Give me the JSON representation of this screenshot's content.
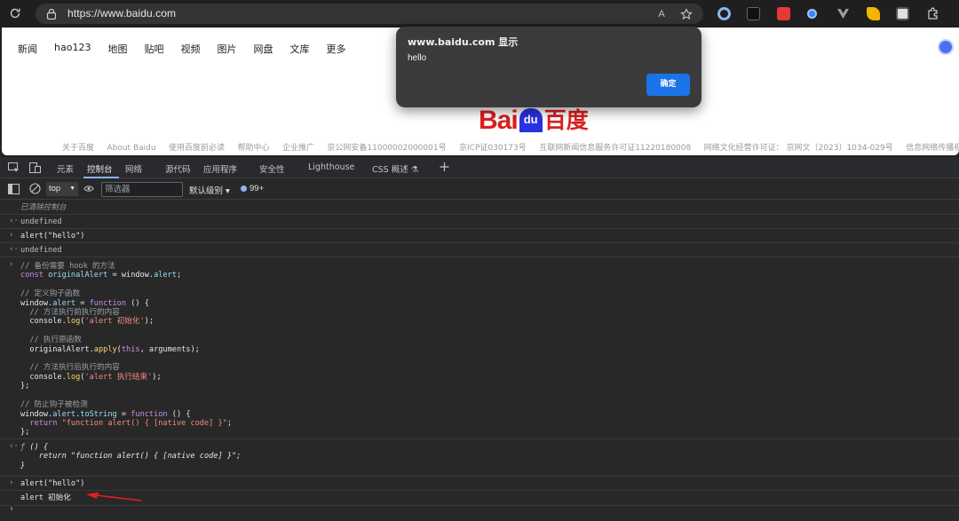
{
  "browser": {
    "url": "https://www.baidu.com",
    "read_aloud_icon": "A",
    "extensions": [
      "ext-circle-icon",
      "ext-tweak-icon",
      "ext-red-icon",
      "ext-blue-icon",
      "ext-vue-icon",
      "ext-yellow-icon",
      "ext-eye-icon",
      "ext-puzzle-icon"
    ]
  },
  "baidu": {
    "nav": [
      "新闻",
      "hao123",
      "地图",
      "贴吧",
      "视频",
      "图片",
      "网盘",
      "文库",
      "更多"
    ],
    "logo_text_latin": "Bai",
    "logo_text_paw": "du",
    "logo_text_cn": "百度",
    "footer": [
      "关于百度",
      "About Baidu",
      "使用百度前必读",
      "帮助中心",
      "企业推广",
      "京公网安备11000002000001号",
      "京ICP证030173号",
      "互联网新闻信息服务许可证11220180008",
      "网络文化经营许可证： 京网文〔2023〕1034-029号",
      "信息网络传播视听节目许可证"
    ]
  },
  "dialog": {
    "title": "www.baidu.com 显示",
    "message": "hello",
    "ok_label": "确定"
  },
  "devtools": {
    "tabs": [
      "元素",
      "控制台",
      "网络",
      "源代码",
      "应用程序",
      "安全性",
      "Lighthouse",
      "CSS 概述 ⚗"
    ],
    "active_tab": "控制台",
    "context": "top",
    "filter_placeholder": "筛选器",
    "levels": "默认级别 ▾",
    "issues_count": "99+"
  },
  "console": {
    "cleared": "已清除控制台",
    "undefined": "undefined",
    "cmd1": "alert(\"hello\")",
    "hook_code": {
      "l1_comment": "// 备份需要 hook 的方法",
      "l2_const": "const",
      "l2_var": "originalAlert",
      "l2_rest": " = window.",
      "l2_prop": "alert",
      "l3_comment": "// 定义钩子函数",
      "l4_a": "window.",
      "l4_prop": "alert",
      "l4_b": " = ",
      "l4_fn": "function",
      "l4_c": " () {",
      "l5_comment": "// 方法执行前执行的内容",
      "l6_a": "console.",
      "l6_fn": "log",
      "l6_b": "(",
      "l6_str": "'alert 初始化'",
      "l6_c": ");",
      "l7_comment": "// 执行原函数",
      "l8_a": "originalAlert.",
      "l8_fn": "apply",
      "l8_b": "(",
      "l8_kw": "this",
      "l8_c": ", arguments);",
      "l9_comment": "// 方法执行后执行的内容",
      "l10_a": "console.",
      "l10_fn": "log",
      "l10_b": "(",
      "l10_str": "'alert 执行结束'",
      "l10_c": ");",
      "l11": "};",
      "l12_comment": "// 防止钩子被检测",
      "l13_a": "window.",
      "l13_prop": "alert",
      "l13_b": ".",
      "l13_fn2": "toString",
      "l13_c": " = ",
      "l13_fn": "function",
      "l13_d": " () {",
      "l14_kw": "return",
      "l14_str": " \"function alert() { [native code] }\"",
      "l14_c": ";",
      "l15": "};"
    },
    "result_fn_f": "ƒ",
    "result_fn_l1": " () {",
    "result_fn_l2": "    return \"function alert() { [native code] }\";",
    "result_fn_l3": "}",
    "cmd2": "alert(\"hello\")",
    "log_output": "alert 初始化"
  },
  "colors": {
    "accent": "#1a73e8",
    "baidu_red": "#de1e1e",
    "baidu_blue": "#2932e1",
    "annotation_arrow": "#e0201c"
  }
}
